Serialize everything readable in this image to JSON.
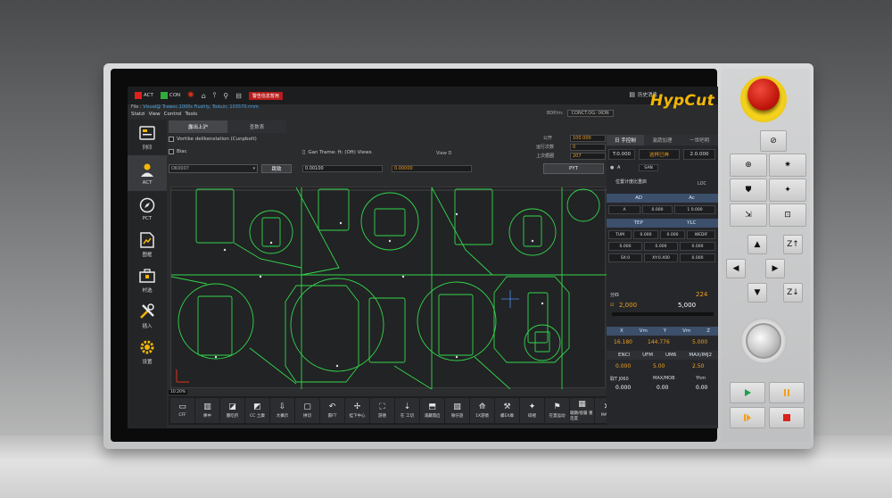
{
  "topbar": {
    "act_label": "ACT",
    "con_label": "CON",
    "alarm_label": "警告信息暂用",
    "history_label": "历史消息",
    "logo": "HypCut"
  },
  "filebar": {
    "label": "File :",
    "path": "Visual@ Trawoc.1000s",
    "detail": "Fiushly, Toduin; 103570.rmm"
  },
  "menu": [
    "Statzi",
    "View",
    "Control",
    "Tools"
  ],
  "bdp": {
    "label": "BDP/m:",
    "value": "CONCT.OG: IXON"
  },
  "sidebar": [
    {
      "label": "列印",
      "icon": "monitor-icon"
    },
    {
      "label": "ACT",
      "icon": "person-icon"
    },
    {
      "label": "PCT",
      "icon": "compass-icon"
    },
    {
      "label": "图框",
      "icon": "chart-file-icon"
    },
    {
      "label": "村选",
      "icon": "toolbox-icon"
    },
    {
      "label": "插入",
      "icon": "wrench-icon"
    },
    {
      "label": "设置",
      "icon": "gear-icon"
    }
  ],
  "tabs": [
    {
      "label": "露出上沪",
      "active": true
    },
    {
      "label": "查数表",
      "active": false
    }
  ],
  "options": {
    "chk1": "Vortike delikenslation (Cunpbolt)",
    "chk2": "Biac",
    "chk3": "Gan Trame: ft: (Oft) Views",
    "view_label": "View D",
    "combo_value": "OK0007",
    "jump_btn": "跳致",
    "val1": "0.00100",
    "val2": "0.00000",
    "run_btn": "PYT",
    "public_label": "公开",
    "public_val": "100.000",
    "count_label": "运行次数",
    "count_val": "0",
    "up_label": "上次循圈",
    "up_val": "207"
  },
  "coord_tag": "10.20%",
  "bottom_buttons": [
    {
      "ic": "▭",
      "label": "CFF"
    },
    {
      "ic": "▥",
      "label": "棒中"
    },
    {
      "ic": "◪",
      "label": "圖吃挤"
    },
    {
      "ic": "◩",
      "label": "CC 土康"
    },
    {
      "ic": "⇩",
      "label": "大攝示"
    },
    {
      "ic": "▢",
      "label": "拼切"
    },
    {
      "ic": "↶",
      "label": "雷FT"
    },
    {
      "ic": "✢",
      "label": "挂下中心"
    },
    {
      "ic": "⛶",
      "label": "游德"
    },
    {
      "ic": "⇣",
      "label": "在 工切"
    },
    {
      "ic": "⬒",
      "label": "浦藏開启"
    },
    {
      "ic": "▧",
      "label": "微仔遊"
    },
    {
      "ic": "⟰",
      "label": "1X游僥"
    },
    {
      "ic": "⚒",
      "label": "螺EX庫"
    },
    {
      "ic": "✦",
      "label": "碎裡"
    },
    {
      "ic": "⚑",
      "label": "在蓋运动"
    },
    {
      "ic": "▦",
      "label": "聴顯/接屬 重连度"
    },
    {
      "ic": "✕",
      "label": "MAOK"
    }
  ],
  "rpanel": {
    "tabs": [
      "日 手控制",
      "激蔬加理",
      "一世吧明"
    ],
    "r1_left": "T:0.000",
    "r1_mid": "这样已奔",
    "r1_right": "2.0.000",
    "radio_label": "A",
    "radio_val": "SAN",
    "pos_label": "位置计度比重启",
    "loc_label": "LOC",
    "ad_label": "AD",
    "ac_label": "Ac",
    "row_a": [
      "A",
      "0.000",
      "1 0.000"
    ],
    "tep_label": "TEP",
    "ylc_label": "YLC",
    "row_tug": [
      "TUM",
      "0.000",
      "0.000",
      "WEDIF"
    ],
    "row_vals": [
      "0.000",
      "0.000",
      "0.000"
    ],
    "row_x": [
      "SX:0",
      "XY:0.X00",
      "0.000"
    ],
    "feed_head_left": "分匹",
    "feed_head_val": "224",
    "feed_left": "2,000",
    "feed_right": "5,000",
    "band1": [
      "X",
      "Vm",
      "Y",
      "Vm",
      "Z"
    ],
    "vals1": [
      "16.180",
      "144.776",
      "5.000"
    ],
    "band2": [
      "ENCI",
      "UFM",
      "UM6",
      "MAX/IMJ2"
    ],
    "vals2": [
      "0.000",
      "5.00",
      "2.50"
    ],
    "row_last_left": "取T J060",
    "row_last_mid": "MAX/MOB",
    "row_last_right": "Yhm",
    "vals3": [
      "0.000",
      "0.00",
      "0.00"
    ]
  },
  "hardware": {
    "buttons_row1": [
      "⊕",
      "✷"
    ],
    "buttons_row2": [
      "⛊",
      "✦"
    ],
    "buttons_row3": [
      "⇲",
      "⊡"
    ],
    "z_up": "Z↑",
    "z_down": "Z↓",
    "arrows": [
      "▲",
      "◀",
      "▶",
      "▼"
    ]
  },
  "colors": {
    "accent": "#f2b705",
    "value_orange": "#f0a020",
    "estop": "#c3180e",
    "cut_line": "#32d74b",
    "start_green": "#1aa34a"
  }
}
